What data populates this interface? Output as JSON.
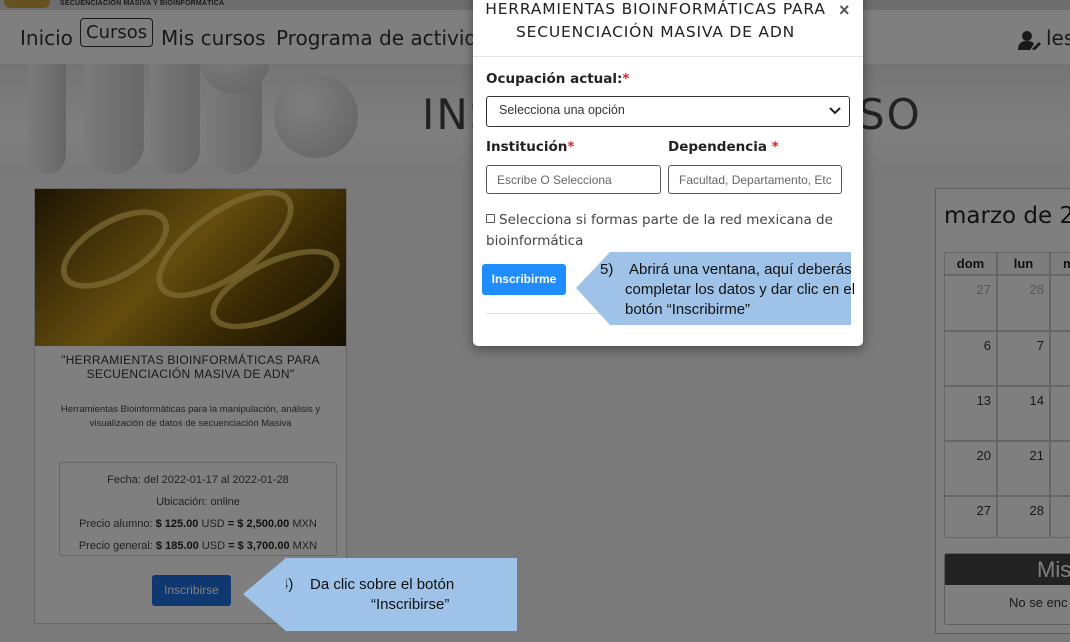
{
  "logo": {
    "text": "SECUENCIACIÓN MASIVA Y BIOINFORMÁTICA"
  },
  "nav": {
    "items": [
      "Inicio",
      "Cursos",
      "Mis cursos",
      "Programa de actividades"
    ],
    "active_index": 1,
    "user_label": "les"
  },
  "hero": {
    "title_left": "INS",
    "title_right": "SO"
  },
  "course": {
    "title": "\"HERRAMIENTAS BIOINFORMÁTICAS PARA SECUENCIACIÓN MASIVA DE ADN\"",
    "description": "Herramientas Bioinformáticas para la manipulación, análisis y visualización de datos de secuenciación Masiva",
    "date": "Fecha: del 2022-01-17 al 2022-01-28",
    "location": "Ubicación: online",
    "price_student_label": "Precio alumno:",
    "price_student_usd": "$ 125.00",
    "price_student_mxn": "$ 2,500.00",
    "price_general_label": "Precio general:",
    "price_general_usd": "$ 185.00",
    "price_general_mxn": "$ 3,700.00",
    "usd": "USD",
    "eq": "=",
    "mxn": "MXN",
    "enroll_button": "Inscribirse"
  },
  "calendar": {
    "title": "marzo de 2",
    "headers": [
      "dom",
      "lun",
      "m"
    ],
    "rows": [
      [
        "27",
        "28",
        ""
      ],
      [
        "6",
        "7",
        ""
      ],
      [
        "13",
        "14",
        ""
      ],
      [
        "20",
        "21",
        ""
      ],
      [
        "27",
        "28",
        ""
      ]
    ],
    "mis_title": "Mis",
    "mis_text": "No se enc"
  },
  "modal": {
    "title": "HERRAMIENTAS BIOINFORMÁTICAS PARA SECUENCIACIÓN MASIVA DE ADN",
    "close": "×",
    "occupation_label": "Ocupación actual:",
    "occupation_placeholder": "Selecciona una opción",
    "institution_label": "Institución",
    "institution_placeholder": "Escribe O Selecciona",
    "dependency_label": "Dependencia",
    "dependency_placeholder": "Facultad, Departamento, Etc",
    "required_mark": "*",
    "checkbox_label": "Selecciona si formas parte de la red mexicana de bioinformática",
    "submit_button": "Inscribirme"
  },
  "callouts": {
    "step5_num": "5)",
    "step5_text": "Abrirá una ventana, aquí deberás completar los datos y dar clic en el botón “Inscribirme”",
    "step4_num": "4)",
    "step4_text_1": "Da clic sobre el botón",
    "step4_text_2": "“Inscribirse”"
  },
  "colors": {
    "primary_button": "#1f6fe0",
    "modal_button": "#1f8cff",
    "callout": "#9fc3e8",
    "required": "#d22222"
  }
}
